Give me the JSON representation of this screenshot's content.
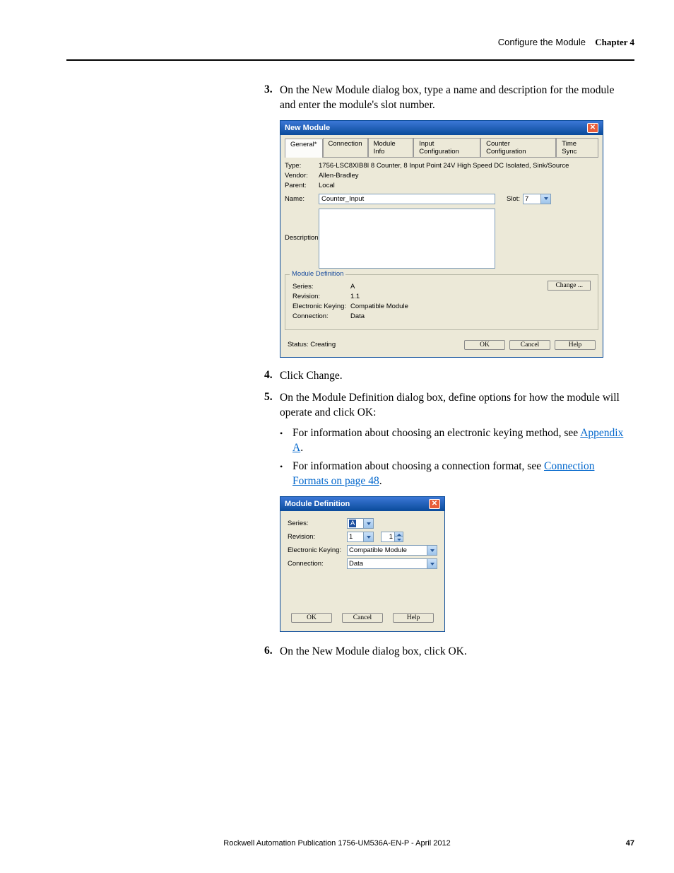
{
  "header": {
    "title": "Configure the Module",
    "chapter": "Chapter 4"
  },
  "steps": {
    "s3": {
      "num": "3.",
      "text": "On the New Module dialog box, type a name and description for the module and enter the module's slot number."
    },
    "s4": {
      "num": "4.",
      "text": "Click Change."
    },
    "s5": {
      "num": "5.",
      "text": "On the Module Definition dialog box, define options for how the module will operate and click OK:"
    },
    "b1": {
      "pre": "For information about choosing an electronic keying method, see ",
      "link": "Appendix A",
      "post": "."
    },
    "b2": {
      "pre": "For information about choosing a connection format, see ",
      "link": "Connection Formats on page 48",
      "post": "."
    },
    "s6": {
      "num": "6.",
      "text": "On the New Module dialog box, click OK."
    }
  },
  "dlg1": {
    "title": "New Module",
    "tabs": [
      "General*",
      "Connection",
      "Module Info",
      "Input Configuration",
      "Counter Configuration",
      "Time Sync"
    ],
    "labels": {
      "type": "Type:",
      "vendor": "Vendor:",
      "parent": "Parent:",
      "name": "Name:",
      "description": "Description:",
      "slot": "Slot:"
    },
    "vals": {
      "type": "1756-LSC8XIB8I 8 Counter, 8 Input Point 24V High Speed DC Isolated, Sink/Source",
      "vendor": "Allen-Bradley",
      "parent": "Local",
      "name": "Counter_Input",
      "slot": "7"
    },
    "md": {
      "legend": "Module Definition",
      "series_l": "Series:",
      "series_v": "A",
      "rev_l": "Revision:",
      "rev_v": "1.1",
      "ek_l": "Electronic Keying:",
      "ek_v": "Compatible Module",
      "conn_l": "Connection:",
      "conn_v": "Data",
      "change": "Change ..."
    },
    "status": "Status: Creating",
    "btns": {
      "ok": "OK",
      "cancel": "Cancel",
      "help": "Help"
    }
  },
  "dlg2": {
    "title": "Module Definition",
    "series_l": "Series:",
    "series_v": "A",
    "rev_l": "Revision:",
    "rev_major": "1",
    "rev_minor": "1",
    "ek_l": "Electronic Keying:",
    "ek_v": "Compatible Module",
    "conn_l": "Connection:",
    "conn_v": "Data",
    "btns": {
      "ok": "OK",
      "cancel": "Cancel",
      "help": "Help"
    }
  },
  "footer": {
    "pub": "Rockwell Automation Publication 1756-UM536A-EN-P - April 2012",
    "page": "47"
  }
}
